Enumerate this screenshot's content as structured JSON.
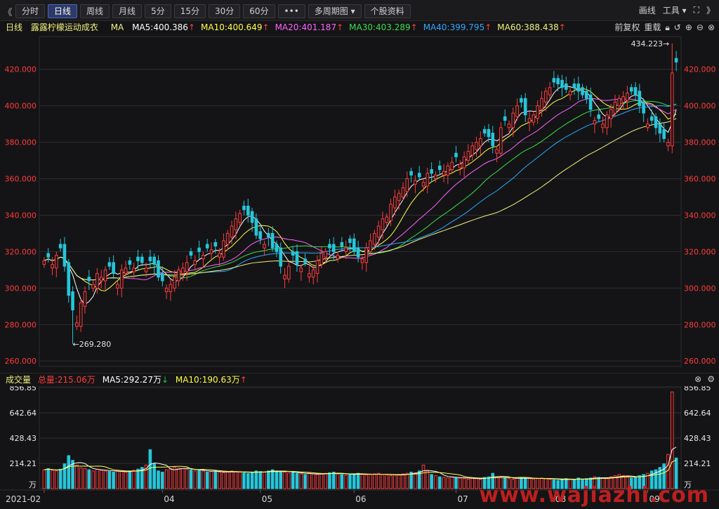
{
  "toolbar": {
    "back_glyph": "《",
    "tabs": [
      {
        "label": "分时",
        "active": false
      },
      {
        "label": "日线",
        "active": true
      },
      {
        "label": "周线",
        "active": false
      },
      {
        "label": "月线",
        "active": false
      },
      {
        "label": "5分",
        "active": false
      },
      {
        "label": "15分",
        "active": false
      },
      {
        "label": "30分",
        "active": false
      },
      {
        "label": "60分",
        "active": false
      },
      {
        "label": "•••",
        "active": false
      },
      {
        "label": "多周期图 ▾",
        "active": false
      },
      {
        "label": "个股资料",
        "active": false
      }
    ],
    "draw_label": "画线",
    "tools_label": "工具 ▾",
    "expand_glyph": "⛶",
    "forward_glyph": "》"
  },
  "ma_header": {
    "period": "日线",
    "stock_name": "露露柠檬运动成衣",
    "ma_label": "MA",
    "items": [
      {
        "text": "MA5:400.386",
        "color": "#ffffff",
        "dir": "up"
      },
      {
        "text": "MA10:400.649",
        "color": "#ffff4a",
        "dir": "up"
      },
      {
        "text": "MA20:401.187",
        "color": "#ff63ff",
        "dir": "up"
      },
      {
        "text": "MA30:403.289",
        "color": "#3ddc4a",
        "dir": "up"
      },
      {
        "text": "MA40:399.795",
        "color": "#2ca8ff",
        "dir": "up"
      },
      {
        "text": "MA60:388.438",
        "color": "#f0f080",
        "dir": "up"
      }
    ],
    "right": [
      "前复权",
      "重载"
    ],
    "up_glyph": "↑",
    "down_glyph": "↓"
  },
  "volume_header": {
    "title": "成交量",
    "total": "总量:215.06万",
    "ma5": "MA5:292.27万",
    "ma10": "MA10:190.63万",
    "ma5_dir": "down",
    "ma10_dir": "up"
  },
  "colors": {
    "up": "#ff3b3b",
    "down": "#26c6da",
    "grid": "#2e2e33",
    "axis_text": "#ff3b3b",
    "vol_axis_text": "#e8e8e8"
  },
  "watermark": "www.wajiazhi.com",
  "chart_data": {
    "type": "candlestick",
    "y_ticks": [
      260,
      280,
      300,
      320,
      340,
      360,
      380,
      400,
      420
    ],
    "y_tick_labels": [
      "260.000",
      "280.000",
      "300.000",
      "320.000",
      "340.000",
      "360.000",
      "380.000",
      "400.000",
      "420.000"
    ],
    "ylim": [
      257,
      438
    ],
    "x_labels": [
      {
        "index": 0,
        "label": "2021-02"
      },
      {
        "index": 29,
        "label": "04"
      },
      {
        "index": 53,
        "label": "05"
      },
      {
        "index": 76,
        "label": "06"
      },
      {
        "index": 101,
        "label": "07"
      },
      {
        "index": 125,
        "label": "08"
      },
      {
        "index": 148,
        "label": "09"
      }
    ],
    "annotations": [
      {
        "label": "←269.280",
        "index": 7,
        "value": 269.28
      },
      {
        "label": "434.223→",
        "index": 154,
        "value": 434.223
      }
    ],
    "closes": [
      315,
      317,
      313,
      318,
      322,
      312,
      296,
      288,
      281,
      292,
      298,
      304,
      302,
      308,
      306,
      310,
      312,
      308,
      302,
      310,
      311,
      313,
      311,
      315,
      314,
      311,
      315,
      313,
      306,
      304,
      300,
      302,
      306,
      310,
      311,
      314,
      318,
      315,
      320,
      318,
      322,
      321,
      323,
      319,
      326,
      330,
      334,
      338,
      341,
      343,
      340,
      336,
      329,
      327,
      324,
      328,
      322,
      320,
      312,
      307,
      312,
      318,
      313,
      311,
      314,
      308,
      310,
      315,
      319,
      320,
      322,
      320,
      318,
      323,
      322,
      325,
      320,
      317,
      316,
      322,
      326,
      330,
      334,
      338,
      339,
      346,
      350,
      352,
      355,
      360,
      362,
      359,
      361,
      358,
      363,
      363,
      362,
      365,
      364,
      367,
      369,
      372,
      368,
      372,
      375,
      378,
      380,
      382,
      385,
      383,
      378,
      376,
      388,
      392,
      390,
      396,
      400,
      402,
      395,
      393,
      395,
      400,
      404,
      408,
      410,
      413,
      412,
      410,
      409,
      408,
      410,
      408,
      406,
      404,
      398,
      392,
      393,
      390,
      395,
      398,
      402,
      404,
      405,
      407,
      408,
      406,
      400,
      396,
      390,
      392,
      388,
      385,
      382,
      380,
      418,
      424
    ],
    "candle_up": [
      1,
      0,
      1,
      1,
      0,
      0,
      0,
      0,
      1,
      1,
      1,
      0,
      1,
      1,
      1,
      1,
      0,
      0,
      1,
      1,
      1,
      0,
      1,
      0,
      0,
      1,
      0,
      0,
      0,
      0,
      1,
      1,
      1,
      1,
      1,
      1,
      0,
      1,
      0,
      1,
      0,
      1,
      0,
      1,
      1,
      1,
      1,
      1,
      1,
      0,
      0,
      0,
      0,
      0,
      1,
      0,
      0,
      0,
      0,
      1,
      1,
      0,
      0,
      1,
      0,
      1,
      1,
      1,
      1,
      1,
      0,
      0,
      1,
      0,
      1,
      0,
      0,
      0,
      1,
      1,
      1,
      1,
      1,
      1,
      1,
      1,
      1,
      1,
      1,
      1,
      0,
      1,
      0,
      1,
      1,
      0,
      1,
      0,
      1,
      1,
      1,
      0,
      1,
      1,
      1,
      1,
      1,
      1,
      0,
      0,
      0,
      1,
      1,
      0,
      1,
      1,
      1,
      0,
      0,
      1,
      1,
      1,
      1,
      1,
      1,
      0,
      0,
      0,
      0,
      1,
      0,
      0,
      0,
      0,
      0,
      1,
      0,
      1,
      1,
      1,
      1,
      1,
      1,
      1,
      0,
      0,
      0,
      0,
      1,
      0,
      0,
      0,
      0,
      1,
      1
    ],
    "volume": {
      "y_ticks": [
        0,
        214.21,
        428.43,
        642.64,
        856.85
      ],
      "y_tick_labels": [
        "万",
        "214.21",
        "428.43",
        "642.64",
        "856.85"
      ],
      "ylim": [
        0,
        856.85
      ],
      "values": [
        160,
        170,
        155,
        150,
        165,
        210,
        280,
        240,
        200,
        175,
        170,
        160,
        150,
        165,
        155,
        150,
        145,
        140,
        150,
        145,
        140,
        150,
        155,
        165,
        180,
        200,
        330,
        210,
        150,
        140,
        160,
        170,
        180,
        175,
        170,
        165,
        160,
        150,
        155,
        150,
        140,
        145,
        150,
        140,
        135,
        140,
        150,
        145,
        140,
        135,
        130,
        140,
        150,
        145,
        140,
        150,
        160,
        150,
        145,
        140,
        135,
        140,
        130,
        125,
        120,
        130,
        125,
        120,
        125,
        130,
        135,
        140,
        125,
        120,
        115,
        120,
        125,
        130,
        120,
        115,
        120,
        125,
        130,
        120,
        115,
        110,
        115,
        120,
        125,
        130,
        140,
        135,
        150,
        200,
        150,
        120,
        110,
        100,
        95,
        90,
        100,
        95,
        90,
        85,
        80,
        90,
        85,
        80,
        95,
        100,
        130,
        100,
        95,
        90,
        85,
        80,
        90,
        95,
        90,
        85,
        80,
        85,
        90,
        85,
        80,
        75,
        70,
        80,
        85,
        80,
        75,
        90,
        80,
        85,
        90,
        100,
        95,
        90,
        85,
        100,
        110,
        120,
        110,
        100,
        90,
        95,
        110,
        120,
        130,
        150,
        160,
        180,
        210,
        290,
        820,
        260
      ],
      "series": [
        {
          "name": "MA5"
        },
        {
          "name": "MA10"
        }
      ]
    },
    "ma_series": [
      "MA5",
      "MA10",
      "MA20",
      "MA30",
      "MA40",
      "MA60"
    ]
  }
}
